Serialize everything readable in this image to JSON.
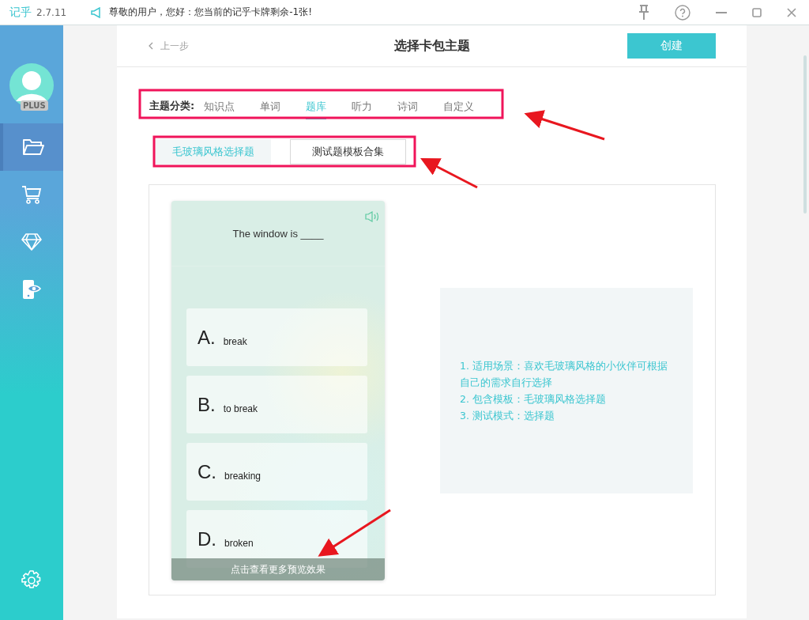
{
  "app": {
    "logo": "记乎",
    "version": "2.7.11",
    "notice": "尊敬的用户，您好：您当前的记乎卡牌剩余-1张!"
  },
  "sidebar": {
    "badge": "PLUS",
    "items": [
      {
        "kind": "folder",
        "selected": true
      },
      {
        "kind": "cart",
        "selected": false
      },
      {
        "kind": "diamond",
        "selected": false
      },
      {
        "kind": "eye",
        "selected": false
      }
    ]
  },
  "header": {
    "back": "上一步",
    "title": "选择卡包主题",
    "create_button": "创建"
  },
  "category": {
    "label": "主题分类:",
    "tabs": [
      {
        "label": "知识点",
        "selected": false
      },
      {
        "label": "单词",
        "selected": false
      },
      {
        "label": "题库",
        "selected": true
      },
      {
        "label": "听力",
        "selected": false
      },
      {
        "label": "诗词",
        "selected": false
      },
      {
        "label": "自定义",
        "selected": false
      }
    ]
  },
  "templates": [
    {
      "label": "毛玻璃风格选择题",
      "selected": true
    },
    {
      "label": "测试题模板合集",
      "selected": false
    }
  ],
  "preview": {
    "question": "The window is ____",
    "options": [
      {
        "letter": "A.",
        "text": "break"
      },
      {
        "letter": "B.",
        "text": "to break"
      },
      {
        "letter": "C.",
        "text": "breaking"
      },
      {
        "letter": "D.",
        "text": "broken"
      }
    ],
    "more": "点击查看更多预览效果"
  },
  "description": [
    "1. 适用场景：喜欢毛玻璃风格的小伙伴可根据自己的需求自行选择",
    "2. 包含模板：毛玻璃风格选择题",
    "3. 测试模式：选择题"
  ]
}
